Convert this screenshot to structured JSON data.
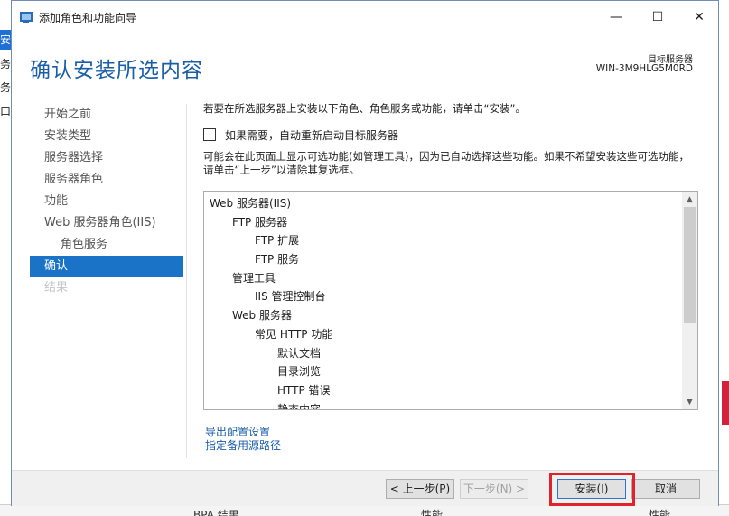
{
  "window": {
    "title": "添加角色和功能向导",
    "minimize": "—",
    "maximize": "☐",
    "close": "✕"
  },
  "background": {
    "left_items": [
      "安",
      "务",
      "务",
      "口"
    ],
    "bottom_items": [
      "BPA 结果",
      "性能",
      "性能"
    ]
  },
  "header": {
    "page_title": "确认安装所选内容",
    "server_label": "目标服务器",
    "server_name": "WIN-3M9HLG5M0RD"
  },
  "nav": {
    "items": [
      {
        "label": "开始之前",
        "state": "normal"
      },
      {
        "label": "安装类型",
        "state": "normal"
      },
      {
        "label": "服务器选择",
        "state": "normal"
      },
      {
        "label": "服务器角色",
        "state": "normal"
      },
      {
        "label": "功能",
        "state": "normal"
      },
      {
        "label": "Web 服务器角色(IIS)",
        "state": "normal"
      },
      {
        "label": "角色服务",
        "state": "sub"
      },
      {
        "label": "确认",
        "state": "active"
      },
      {
        "label": "结果",
        "state": "disabled"
      }
    ]
  },
  "content": {
    "intro": "若要在所选服务器上安装以下角色、角色服务或功能，请单击“安装”。",
    "restart_checkbox": {
      "label": "如果需要，自动重新启动目标服务器",
      "checked": false
    },
    "note": "可能会在此页面上显示可选功能(如管理工具)，因为已自动选择这些功能。如果不希望安装这些可选功能，请单击“上一步”以清除其复选框。",
    "tree": [
      {
        "text": "Web 服务器(IIS)",
        "level": 1
      },
      {
        "text": "FTP 服务器",
        "level": 2
      },
      {
        "text": "FTP 扩展",
        "level": 3
      },
      {
        "text": "FTP 服务",
        "level": 3
      },
      {
        "text": "管理工具",
        "level": 2
      },
      {
        "text": "IIS 管理控制台",
        "level": 3
      },
      {
        "text": "Web 服务器",
        "level": 2
      },
      {
        "text": "常见 HTTP 功能",
        "level": 3
      },
      {
        "text": "默认文档",
        "level": 4
      },
      {
        "text": "目录浏览",
        "level": 4
      },
      {
        "text": "HTTP 错误",
        "level": 4
      },
      {
        "text": "静态内容",
        "level": 4
      }
    ],
    "links": {
      "export": "导出配置设置",
      "alt_source": "指定备用源路径"
    }
  },
  "footer": {
    "prev": "< 上一步(P)",
    "next": "下一步(N) >",
    "install": "安装(I)",
    "cancel": "取消"
  },
  "colors": {
    "accent": "#1a73c6",
    "title_blue": "#1a5ea8",
    "highlight_red": "#e0232a"
  }
}
